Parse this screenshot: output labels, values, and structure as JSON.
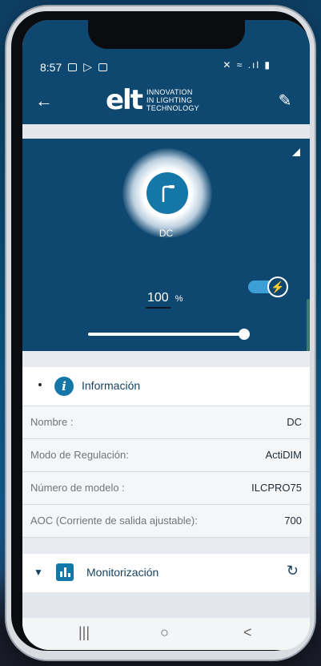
{
  "status_bar": {
    "time": "8:57",
    "right_icons": "mute-wifi-signal-battery"
  },
  "app_bar": {
    "back_icon": "arrow-left-icon",
    "edit_icon": "pencil-icon",
    "logo": {
      "mark": "elt",
      "line1": "INNOVATION",
      "line2": "IN LIGHTING",
      "line3": "TECHNOLOGY"
    }
  },
  "lamp": {
    "name": "DC",
    "icon": "street-lamp-icon",
    "level": "100",
    "unit": "%",
    "slider_fraction": 1.0,
    "toggle_on": true
  },
  "info": {
    "title": "Información",
    "rows": [
      {
        "label": "Nombre :",
        "value": "DC"
      },
      {
        "label": "Modo de Regulación:",
        "value": "ActiDIM"
      },
      {
        "label": "Número de modelo :",
        "value": "ILCPRO75"
      },
      {
        "label": "AOC (Corriente de salida ajustable):",
        "value": "700"
      }
    ]
  },
  "monitor": {
    "title": "Monitorización",
    "refresh_icon": "refresh-icon"
  },
  "nav": {
    "recent": "|||",
    "home": "○",
    "back": "<"
  },
  "colors": {
    "primary": "#0e4770",
    "accent": "#1576a8",
    "toggle": "#3e9fd6"
  }
}
